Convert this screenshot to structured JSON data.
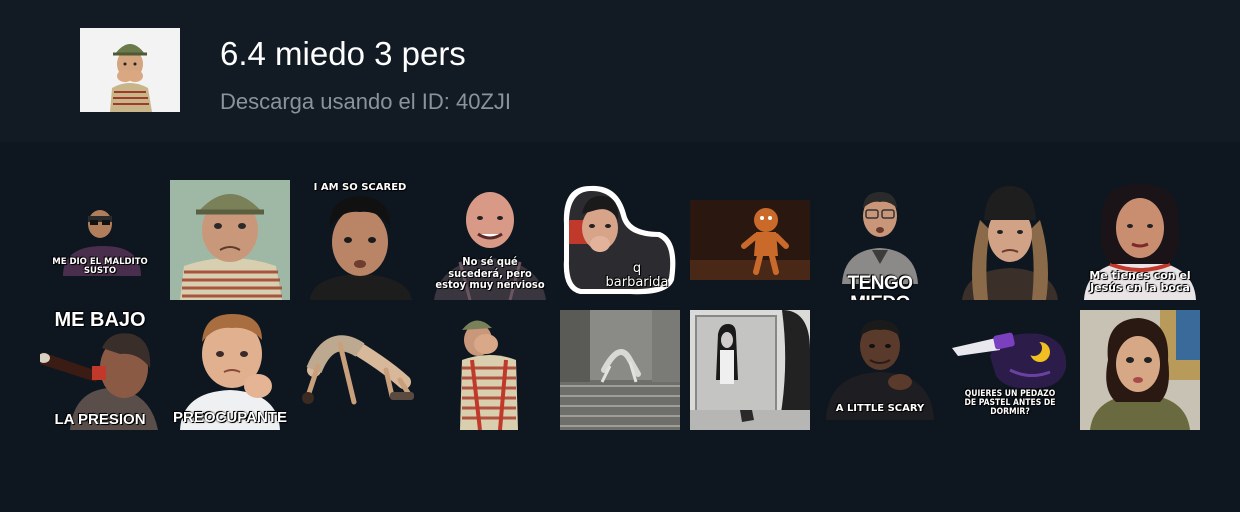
{
  "pack": {
    "title": "6.4 miedo 3 pers",
    "subtitle": "Descarga usando el ID: 40ZJI"
  },
  "stickers": [
    {
      "id": "s1",
      "caption": "ME DIO EL MALDITO SUSTO",
      "icon": "scared-man-sunglasses"
    },
    {
      "id": "s2",
      "caption": "",
      "icon": "chavo-worried-photo"
    },
    {
      "id": "s3",
      "caption": "I AM SO SCARED",
      "icon": "scared-young-man"
    },
    {
      "id": "s4",
      "caption": "No sé qué sucederá, pero estoy muy nervioso",
      "icon": "nervous-bald-man"
    },
    {
      "id": "s5",
      "caption": "q barbarida",
      "icon": "shocked-man-hand-mouth"
    },
    {
      "id": "s6",
      "caption": "",
      "icon": "gingerbread-man"
    },
    {
      "id": "s7",
      "caption": "TENGO MIEDO",
      "icon": "scared-man-glasses"
    },
    {
      "id": "s8",
      "caption": "",
      "icon": "man-beanie-worried"
    },
    {
      "id": "s9",
      "caption": "Me tienes con el Jesús en la boca",
      "icon": "worried-woman"
    },
    {
      "id": "s10",
      "caption_top": "ME BAJO",
      "caption": "LA PRESION",
      "icon": "woman-drinking-soda"
    },
    {
      "id": "s11",
      "caption": "PREOCUPANTE",
      "icon": "worried-toddler"
    },
    {
      "id": "s12",
      "caption": "",
      "icon": "bridge-pose-figure"
    },
    {
      "id": "s13",
      "caption": "",
      "icon": "chavo-covering-face"
    },
    {
      "id": "s14",
      "caption": "",
      "icon": "spider-walk-stairs"
    },
    {
      "id": "s15",
      "caption": "",
      "icon": "ghost-girl-mirror"
    },
    {
      "id": "s16",
      "caption": "A LITTLE SCARY",
      "icon": "scientist-little-scary"
    },
    {
      "id": "s17",
      "caption": "QUIERES UN PEDAZO DE PASTEL ANTES DE DORMIR?",
      "icon": "knife-cartoon"
    },
    {
      "id": "s18",
      "caption": "",
      "icon": "shocked-woman"
    }
  ],
  "colors": {
    "page_bg": "#0e1720",
    "header_bg": "#121b24",
    "title": "#ffffff",
    "subtitle": "#8a929a"
  }
}
